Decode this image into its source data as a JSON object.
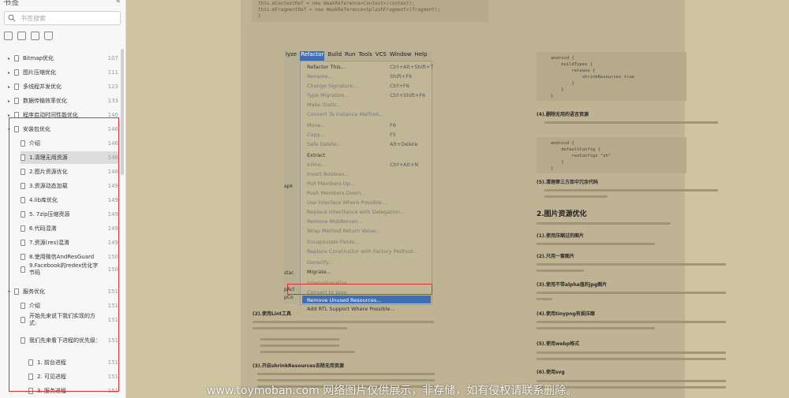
{
  "sidebar": {
    "title": "书签",
    "search_placeholder": "书签搜索",
    "items": [
      {
        "label": "Bitmap优化",
        "page": "107",
        "level": 1
      },
      {
        "label": "图片压缩优化",
        "page": "111",
        "level": 1
      },
      {
        "label": "多线程并发优化",
        "page": "123",
        "level": 1
      },
      {
        "label": "数据传输效率优化",
        "page": "133",
        "level": 1
      },
      {
        "label": "程序启动时间性能优化",
        "page": "140",
        "level": 1
      },
      {
        "label": "安装包优化",
        "page": "146",
        "level": 1,
        "expanded": true
      },
      {
        "label": "介绍",
        "page": "146",
        "level": 2
      },
      {
        "label": "1.清理无用资源",
        "page": "146",
        "level": 2,
        "selected": true
      },
      {
        "label": "2.图片资源优化",
        "page": "148",
        "level": 2
      },
      {
        "label": "3.资源动态加载",
        "page": "149",
        "level": 2
      },
      {
        "label": "4.lib库优化",
        "page": "149",
        "level": 2
      },
      {
        "label": "5. 7zip压缩资源",
        "page": "149",
        "level": 2
      },
      {
        "label": "6.代码混淆",
        "page": "149",
        "level": 2
      },
      {
        "label": "7.资源(res)混淆",
        "page": "149",
        "level": 2
      },
      {
        "label": "8.使用微信AndResGuard",
        "page": "150",
        "level": 2
      },
      {
        "label": "9.Facebook的redex优化字节码",
        "page": "150",
        "level": 2
      },
      {
        "label": "服务优化",
        "page": "151",
        "level": 1,
        "expanded": true
      },
      {
        "label": "介绍",
        "page": "151",
        "level": 2
      },
      {
        "label": "开始先来说下我们实现的方式:",
        "page": "151",
        "level": 2
      },
      {
        "label": "我们先来看下进程的优先级：",
        "page": "151",
        "level": 2
      },
      {
        "label": "1. 前台进程",
        "page": "151",
        "level": 3
      },
      {
        "label": "2. 可见进程",
        "page": "151",
        "level": 3
      },
      {
        "label": "3. 服务进程",
        "page": "151",
        "level": 3
      }
    ]
  },
  "document": {
    "code_top": [
      "this.mContextRef = new WeakReference<Context>(context);",
      "this.mFragmentRef = new WeakReference<SplashFragment>(fragment);",
      "}"
    ],
    "ide_menubar": [
      "lyze",
      "Refactor",
      "Build",
      "Run",
      "Tools",
      "VCS",
      "Window",
      "Help"
    ],
    "ide_menu": [
      {
        "label": "Refactor This...",
        "shortcut": "Ctrl+Alt+Shift+T",
        "dim": false
      },
      {
        "label": "Rename...",
        "shortcut": "Shift+F6",
        "dim": true
      },
      {
        "label": "Change Signature...",
        "shortcut": "Ctrl+F6",
        "dim": true
      },
      {
        "label": "Type Migration...",
        "shortcut": "Ctrl+Shift+F6",
        "dim": true
      },
      {
        "label": "Make Static...",
        "shortcut": "",
        "dim": true
      },
      {
        "label": "Convert To Instance Method...",
        "shortcut": "",
        "dim": true
      },
      {
        "label": "Move...",
        "shortcut": "F6",
        "dim": true
      },
      {
        "label": "Copy...",
        "shortcut": "F5",
        "dim": true
      },
      {
        "label": "Safe Delete...",
        "shortcut": "Alt+Delete",
        "dim": true
      },
      {
        "label": "Extract",
        "shortcut": "",
        "dim": false
      },
      {
        "label": "Inline...",
        "shortcut": "Ctrl+Alt+N",
        "dim": true
      },
      {
        "label": "Invert Boolean...",
        "shortcut": "",
        "dim": true
      },
      {
        "label": "Pull Members Up...",
        "shortcut": "",
        "dim": true
      },
      {
        "label": "Push Members Down...",
        "shortcut": "",
        "dim": true
      },
      {
        "label": "Use Interface Where Possible...",
        "shortcut": "",
        "dim": true
      },
      {
        "label": "Replace Inheritance with Delegation...",
        "shortcut": "",
        "dim": true
      },
      {
        "label": "Remove Middleman...",
        "shortcut": "",
        "dim": true
      },
      {
        "label": "Wrap Method Return Value...",
        "shortcut": "",
        "dim": true
      },
      {
        "label": "Encapsulate Fields...",
        "shortcut": "",
        "dim": true
      },
      {
        "label": "Replace Constructor with Factory Method...",
        "shortcut": "",
        "dim": true
      },
      {
        "label": "Generify...",
        "shortcut": "",
        "dim": true
      },
      {
        "label": "Migrate...",
        "shortcut": "",
        "dim": false
      },
      {
        "label": "Internationalize...",
        "shortcut": "",
        "dim": true
      },
      {
        "label": "Convert to Java",
        "shortcut": "",
        "dim": true
      },
      {
        "label": "Remove Unused Resources...",
        "shortcut": "",
        "dim": false,
        "highlight": true
      },
      {
        "label": "Add RTL Support Where Possible...",
        "shortcut": "",
        "dim": false
      }
    ],
    "ide_side_labels": [
      "apk",
      "stac",
      "pAct",
      "pCo"
    ],
    "left_headings": [
      "(2).使用Lint工具",
      "(3).开启shrinkResources去除无用资源"
    ],
    "right_code_1": "android {\n    buildTypes {\n        release {\n            shrinkResources true\n        }\n    }\n}",
    "right_heading_1": "(4).删除无用的语言资源",
    "right_code_2": "android {\n    defaultConfig {\n        resConfigs \"zh\"\n    }\n}",
    "right_heading_2": "(5).清理第三方库中冗余代码",
    "section_title": "2.图片资源优化",
    "right_subheads": [
      "(1).使用压缩过的图片",
      "(2).只用一套图片",
      "(3).使用不带alpha值的jpg图片",
      "(4).使用tinypng有损压缩",
      "(5).使用webp格式",
      "(6).使用svg"
    ],
    "watermark": "www.toymoban.com 网络图片仅供展示，非存储，如有侵权请联系删除。"
  }
}
